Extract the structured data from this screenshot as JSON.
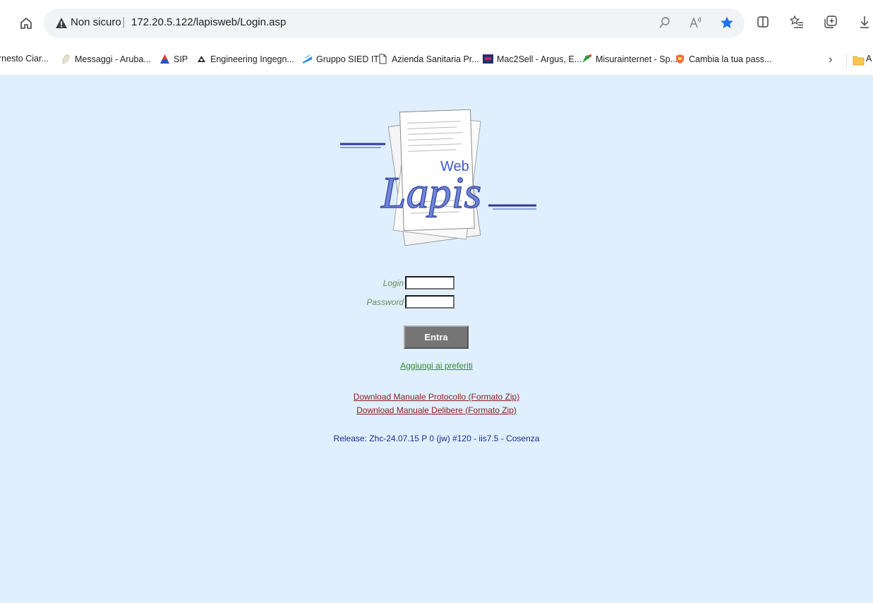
{
  "browser": {
    "address": {
      "security_label": "Non sicuro",
      "separator": "|",
      "url": "172.20.5.122/lapisweb/Login.asp"
    },
    "icons": [
      "home-icon",
      "warning-icon",
      "search-page-icon",
      "read-aloud-icon",
      "favorite-star-icon",
      "split-screen-icon",
      "favorites-list-icon",
      "collections-icon",
      "download-icon"
    ],
    "accent_color": "#1a73e8"
  },
  "bookmarks": {
    "items": [
      {
        "label": "rnesto Ciar..."
      },
      {
        "label": "Messaggi - Aruba..."
      },
      {
        "label": "SIP"
      },
      {
        "label": "Engineering Ingegn..."
      },
      {
        "label": "Gruppo SIED IT"
      },
      {
        "label": "Azienda Sanitaria Pr..."
      },
      {
        "label": "Mac2Sell - Argus, E..."
      },
      {
        "label": "Misurainternet - Sp..."
      },
      {
        "label": "Cambia la tua pass..."
      }
    ],
    "more": "›",
    "folder_label": "A"
  },
  "page": {
    "background": "#dfeffd",
    "logo": {
      "word": "Lapis",
      "suffix": "Web"
    },
    "login_label": "Login",
    "password_label": "Password",
    "login_value": "",
    "password_value": "",
    "enter_button": "Entra",
    "favorites_link": "Aggiungi ai preferiti",
    "download_protocollo": "Download Manuale Protocollo (Formato Zip)",
    "download_delibere": "Download Manuale Delibere (Formato Zip)",
    "release": "Release:  Zhc-24.07.15 P 0 (jw)  #120 -  iis7.5  -  Cosenza"
  }
}
